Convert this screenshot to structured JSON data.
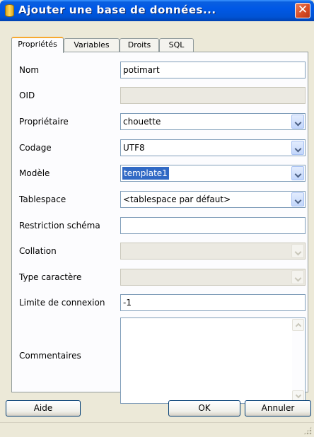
{
  "window": {
    "title": "Ajouter une base de données...",
    "close_glyph": "✕",
    "colors": {
      "titlebar": "#0058e6",
      "accent_tab": "#f7a930",
      "selection": "#316ac5"
    }
  },
  "tabs": [
    {
      "label": "Propriétés",
      "active": true
    },
    {
      "label": "Variables",
      "active": false
    },
    {
      "label": "Droits",
      "active": false
    },
    {
      "label": "SQL",
      "active": false
    }
  ],
  "form": {
    "nom": {
      "label": "Nom",
      "value": "potimart"
    },
    "oid": {
      "label": "OID",
      "value": ""
    },
    "proprietaire": {
      "label": "Propriétaire",
      "value": "chouette"
    },
    "codage": {
      "label": "Codage",
      "value": "UTF8"
    },
    "modele": {
      "label": "Modèle",
      "value": "template1"
    },
    "tablespace": {
      "label": "Tablespace",
      "value": "<tablespace par défaut>"
    },
    "restriction": {
      "label": "Restriction schéma",
      "value": ""
    },
    "collation": {
      "label": "Collation",
      "value": ""
    },
    "type_caractere": {
      "label": "Type caractère",
      "value": ""
    },
    "limite": {
      "label": "Limite de connexion",
      "value": "-1"
    },
    "commentaires": {
      "label": "Commentaires",
      "value": ""
    }
  },
  "buttons": {
    "help": "Aide",
    "ok": "OK",
    "cancel": "Annuler"
  },
  "icons": {
    "app": "database-icon",
    "dropdown": "chevron-down-icon",
    "scroll_up": "scroll-up-icon",
    "scroll_down": "scroll-down-icon",
    "grip": "resize-grip-icon"
  }
}
